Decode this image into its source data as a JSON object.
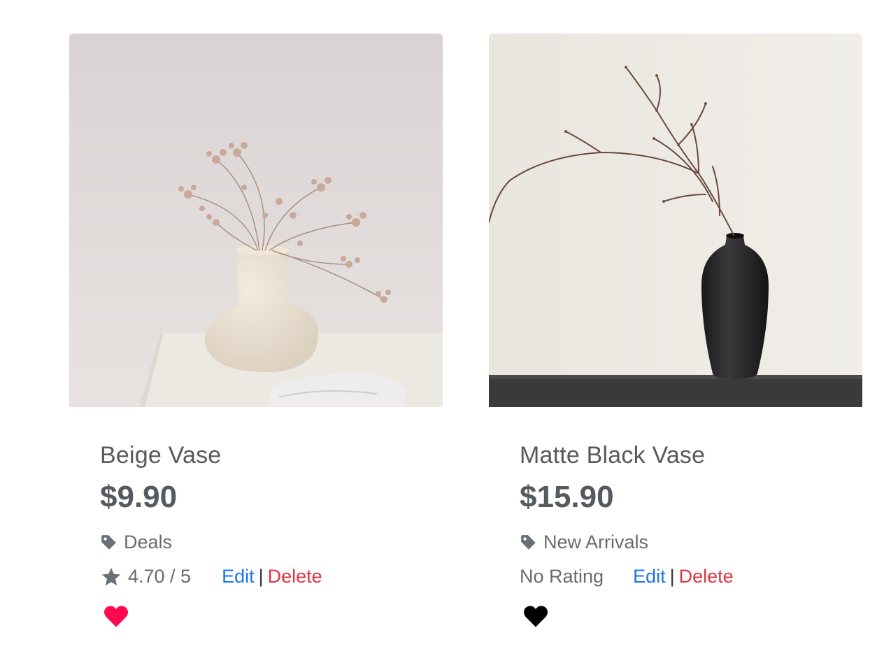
{
  "products": [
    {
      "name": "Beige Vase",
      "price": "$9.90",
      "category": "Deals",
      "rating_text": "4.70 / 5",
      "edit_label": "Edit",
      "separator": "|",
      "delete_label": "Delete",
      "favorited": true,
      "heart_color": "#ff0a4e",
      "icons": [
        "tag-icon",
        "star-icon",
        "heart-icon"
      ]
    },
    {
      "name": "Matte Black Vase",
      "price": "$15.90",
      "category": "New Arrivals",
      "rating_text": "No Rating",
      "edit_label": "Edit",
      "separator": "|",
      "delete_label": "Delete",
      "favorited": false,
      "heart_color": "#000000",
      "icons": [
        "tag-icon",
        "heart-icon"
      ]
    }
  ],
  "colors": {
    "edit": "#1b74e4",
    "delete": "#dc3545",
    "text": "#555a5f",
    "muted": "#666b70"
  }
}
